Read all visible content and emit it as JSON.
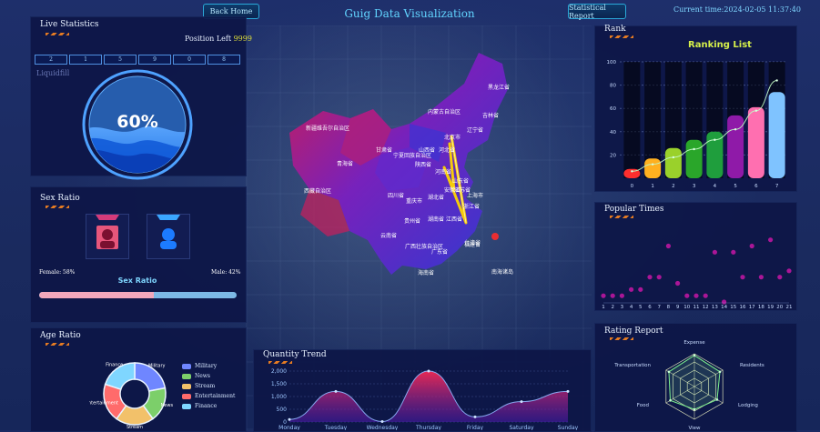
{
  "app": {
    "title": "Guig Data Visualization"
  },
  "topbar": {
    "back_home": "Back Home",
    "statistical_report": "Statistical Report",
    "current_time": "Current time:2024-02-05 11:37:40"
  },
  "panels": {
    "live_statistics": {
      "title": "Live Statistics",
      "position_left_label": "Position Left",
      "position_left_value": "9999",
      "liquidfill_label": "Liquidfill",
      "percent_text": "60%",
      "percent_value": 0.6,
      "digits": [
        "2",
        "1",
        "5",
        "9",
        "0",
        "8"
      ]
    },
    "sex_ratio": {
      "title": "Sex Ratio",
      "female": "Female: 58%",
      "male": "Male: 42%",
      "chart_title": "Sex Ratio",
      "female_fraction": 0.58
    },
    "age_ratio": {
      "title": "Age Ratio"
    },
    "quantity_trend": {
      "title": "Quantity Trend"
    },
    "rank": {
      "title": "Rank",
      "chart_title": "Ranking List"
    },
    "popular_times": {
      "title": "Popular Times"
    },
    "rating_report": {
      "title": "Rating Report"
    }
  },
  "map": {
    "labels": [
      "新疆维吾尔自治区",
      "西藏自治区",
      "青海省",
      "甘肃省",
      "内蒙古自治区",
      "黑龙江省",
      "吉林省",
      "辽宁省",
      "北京市",
      "河北省",
      "山西省",
      "宁夏回族自治区",
      "陕西省",
      "河南省",
      "山东省",
      "四川省",
      "重庆市",
      "湖北省",
      "安徽省",
      "江苏省",
      "上海市",
      "浙江省",
      "湖南省",
      "江西省",
      "贵州省",
      "云南省",
      "广西壮族自治区",
      "广东省",
      "福建省",
      "台湾省",
      "海南省",
      "南海诸岛"
    ]
  },
  "chart_data": [
    {
      "type": "pie",
      "title": "",
      "categories": [
        "Military",
        "News",
        "Stream",
        "Entertainment",
        "Finance"
      ],
      "values": [
        22,
        18,
        20,
        20,
        20
      ],
      "colors": [
        "#6f86ff",
        "#7ccf6a",
        "#f2c16a",
        "#ff6b6b",
        "#7fd6ff"
      ],
      "legend_position": "right"
    },
    {
      "type": "area",
      "title": "",
      "x": [
        "Monday",
        "Tuesday",
        "Wednesday",
        "Thursday",
        "Friday",
        "Saturday",
        "Sunday"
      ],
      "series": [
        {
          "name": "",
          "values": [
            100,
            1200,
            20,
            2200,
            200,
            800,
            1200
          ]
        }
      ],
      "ylim": [
        0,
        2000
      ],
      "y_ticks": [
        0,
        500,
        1000,
        1500,
        2000
      ]
    },
    {
      "type": "bar",
      "title": "Ranking List",
      "categories": [
        "0",
        "1",
        "2",
        "3",
        "4",
        "5",
        "6",
        "7"
      ],
      "values": [
        8,
        17,
        26,
        33,
        40,
        54,
        61,
        74
      ],
      "max_per_bar": 100,
      "trend_line": [
        6,
        12,
        18,
        25,
        33,
        42,
        58,
        84
      ],
      "colors": [
        "#ff2e2e",
        "#ffb020",
        "#9ad12b",
        "#2aa62a",
        "#1f9e3d",
        "#8f1aa8",
        "#ff6fb0",
        "#7fc3ff"
      ]
    },
    {
      "type": "scatter",
      "title": "",
      "x": [
        "1",
        "2",
        "3",
        "4",
        "5",
        "6",
        "7",
        "8",
        "9",
        "10",
        "11",
        "12",
        "13",
        "14",
        "15",
        "16",
        "17",
        "18",
        "19",
        "20",
        "21"
      ],
      "series": [
        {
          "name": "",
          "values": [
            1,
            1,
            1,
            2,
            2,
            4,
            4,
            9,
            3,
            1,
            1,
            1,
            8,
            0,
            8,
            4,
            9,
            4,
            10,
            4,
            5
          ]
        }
      ],
      "ylim": [
        0,
        12
      ]
    },
    {
      "type": "radar",
      "title": "",
      "indicators": [
        "Expense",
        "Residents",
        "Lodging",
        "View",
        "Food",
        "Transportation"
      ],
      "values": [
        0.95,
        0.9,
        0.8,
        0.7,
        0.85,
        0.9
      ]
    }
  ]
}
